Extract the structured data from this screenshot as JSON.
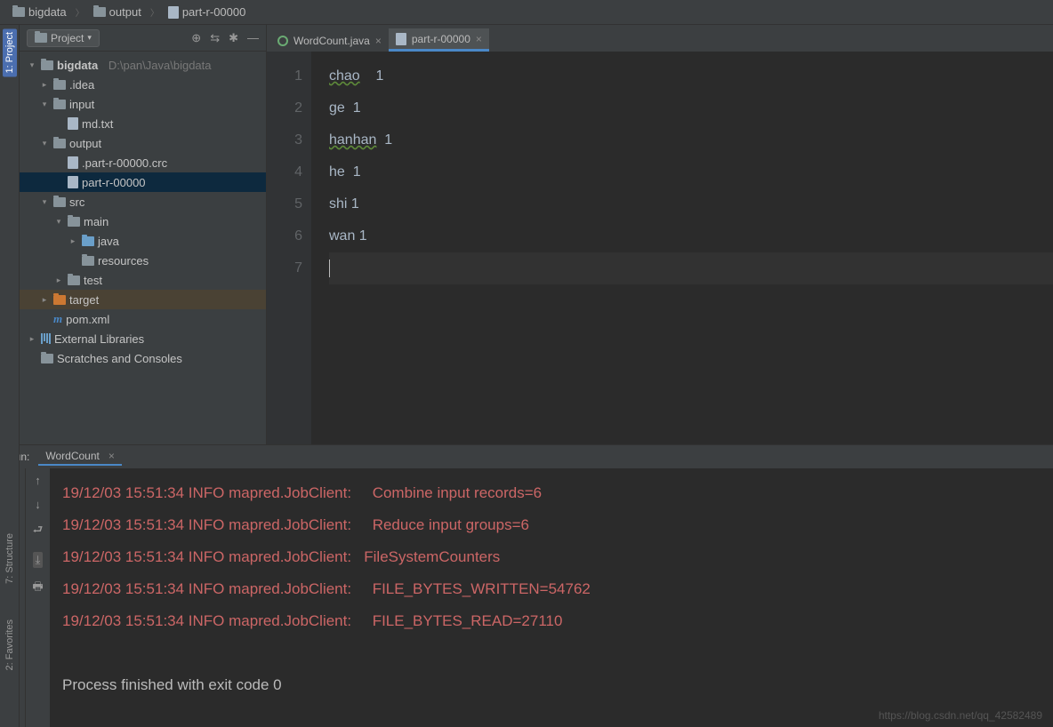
{
  "breadcrumb": {
    "root": "bigdata",
    "mid": "output",
    "leaf": "part-r-00000"
  },
  "projHead": {
    "label": "Project"
  },
  "tree": {
    "root": "bigdata",
    "rootPath": "D:\\pan\\Java\\bigdata",
    "idea": ".idea",
    "input": "input",
    "md": "md.txt",
    "output": "output",
    "crc": ".part-r-00000.crc",
    "partr": "part-r-00000",
    "src": "src",
    "smain": "main",
    "sjava": "java",
    "sres": "resources",
    "stest": "test",
    "target": "target",
    "pom": "pom.xml",
    "ext": "External Libraries",
    "scratch": "Scratches and Consoles"
  },
  "tabs": {
    "t1": "WordCount.java",
    "t2": "part-r-00000"
  },
  "lines": [
    "1",
    "2",
    "3",
    "4",
    "5",
    "6",
    "7"
  ],
  "code": {
    "l1a": "chao",
    "l1b": "    1",
    "l2": "ge  1",
    "l3a": "hanhan",
    "l3b": "  1",
    "l4": "he  1",
    "l5": "shi 1",
    "l6": "wan 1"
  },
  "run": {
    "label": "Run:",
    "tab": "WordCount"
  },
  "console": {
    "l1": "19/12/03 15:51:34 INFO mapred.JobClient:     Combine input records=6",
    "l2": "19/12/03 15:51:34 INFO mapred.JobClient:     Reduce input groups=6",
    "l3": "19/12/03 15:51:34 INFO mapred.JobClient:   FileSystemCounters",
    "l4": "19/12/03 15:51:34 INFO mapred.JobClient:     FILE_BYTES_WRITTEN=54762",
    "l5": "19/12/03 15:51:34 INFO mapred.JobClient:     FILE_BYTES_READ=27110",
    "exit": "Process finished with exit code 0"
  },
  "sideTabs": {
    "project": "1: Project",
    "structure": "7: Structure",
    "favorites": "2: Favorites"
  },
  "watermark": "https://blog.csdn.net/qq_42582489"
}
